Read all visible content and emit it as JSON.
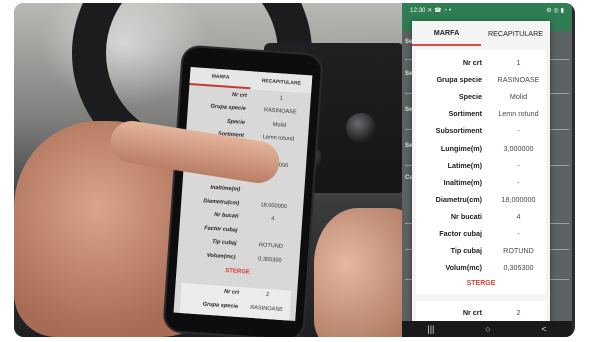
{
  "photo_phone": {
    "tabs": [
      "MARFA",
      "RECAPITULARE"
    ],
    "rows": [
      {
        "label": "Nr crt",
        "value": "1"
      },
      {
        "label": "Grupa specie",
        "value": "RASINOASE"
      },
      {
        "label": "Specie",
        "value": "Molid"
      },
      {
        "label": "Sortiment",
        "value": "Lemn rotund"
      },
      {
        "label": "Subsortiment",
        "value": ""
      },
      {
        "label": "",
        "value": "3,000000"
      },
      {
        "label": "",
        "value": ""
      },
      {
        "label": "Inaltime(m)",
        "value": ""
      },
      {
        "label": "Diametru(cm)",
        "value": "18,000000"
      },
      {
        "label": "Nr bucati",
        "value": "4"
      },
      {
        "label": "Factor cubaj",
        "value": ""
      },
      {
        "label": "Tip cubaj",
        "value": "ROTUND"
      },
      {
        "label": "Volum(mc)",
        "value": "0,305300"
      }
    ],
    "delete_label": "STERGE",
    "next_rows": [
      {
        "label": "Nr crt",
        "value": "2"
      },
      {
        "label": "Grupa specie",
        "value": "RASINOASE"
      }
    ]
  },
  "screen": {
    "status_time": "12:30",
    "status_icons_left": "✕ ☎ ◔ •",
    "status_icons_right": "⚙ ◎ ▮",
    "behind_labels": [
      "Sel",
      "Sel",
      "Sel",
      "Sel",
      "Cu"
    ],
    "tabs": [
      "MARFA",
      "RECAPITULARE"
    ],
    "rows": [
      {
        "label": "Nr crt",
        "value": "1"
      },
      {
        "label": "Grupa specie",
        "value": "RASINOASE"
      },
      {
        "label": "Specie",
        "value": "Molid"
      },
      {
        "label": "Sortiment",
        "value": "Lemn rotund"
      },
      {
        "label": "Subsortiment",
        "value": "-"
      },
      {
        "label": "Lungime(m)",
        "value": "3,000000"
      },
      {
        "label": "Latime(m)",
        "value": "-"
      },
      {
        "label": "Inaltime(m)",
        "value": "-"
      },
      {
        "label": "Diametru(cm)",
        "value": "18,000000"
      },
      {
        "label": "Nr bucati",
        "value": "4"
      },
      {
        "label": "Factor cubaj",
        "value": "-"
      },
      {
        "label": "Tip cubaj",
        "value": "ROTUND"
      },
      {
        "label": "Volum(mc)",
        "value": "0,305300"
      }
    ],
    "delete_label": "STERGE",
    "next_rows": [
      {
        "label": "Nr crt",
        "value": "2"
      },
      {
        "label": "Grupa specie",
        "value": "RASINOASE"
      }
    ],
    "nav": {
      "recents": "|||",
      "home": "○",
      "back": "<"
    }
  },
  "colors": {
    "accent": "#d9413a",
    "status_bar": "#2f7d52"
  }
}
